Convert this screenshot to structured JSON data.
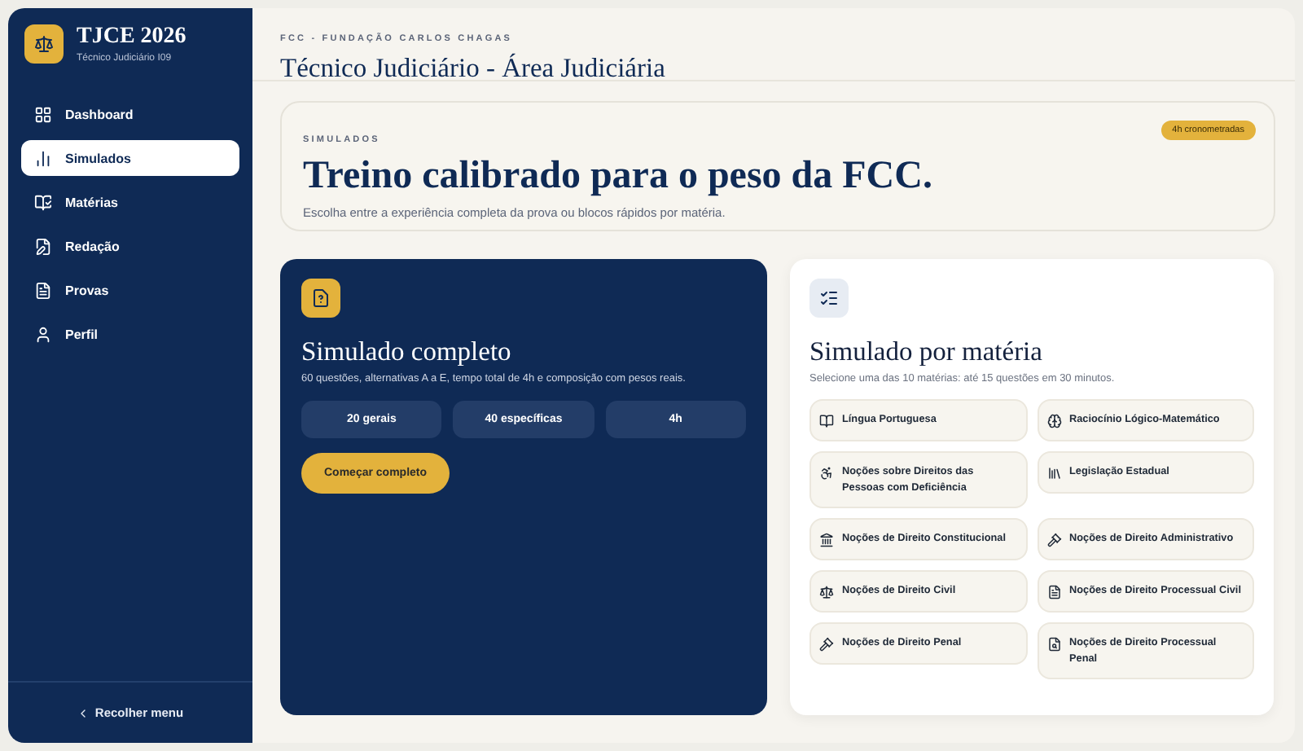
{
  "sidebar": {
    "brand": {
      "title": "TJCE 2026",
      "subtitle": "Técnico Judiciário I09"
    },
    "items": [
      {
        "label": "Dashboard",
        "selected": false
      },
      {
        "label": "Simulados",
        "selected": true
      },
      {
        "label": "Matérias",
        "selected": false
      },
      {
        "label": "Redação",
        "selected": false
      },
      {
        "label": "Provas",
        "selected": false
      },
      {
        "label": "Perfil",
        "selected": false
      }
    ],
    "collapse": "Recolher menu"
  },
  "header": {
    "eyebrow": "FCC - FUNDAÇÃO CARLOS CHAGAS",
    "title": "Técnico Judiciário - Área Judiciária"
  },
  "hero": {
    "eyebrow": "SIMULADOS",
    "title": "Treino calibrado para o peso da FCC.",
    "description": "Escolha entre a experiência completa da prova ou blocos rápidos por matéria.",
    "badge": "4h cronometradas"
  },
  "full_exam": {
    "title": "Simulado completo",
    "description": "60 questões, alternativas A a E, tempo total de 4h e composição com pesos reais.",
    "stats": [
      "20 gerais",
      "40 específicas",
      "4h"
    ],
    "button": "Começar completo"
  },
  "by_subject": {
    "title": "Simulado por matéria",
    "description": "Selecione uma das 10 matérias: até 15 questões em 30 minutos.",
    "subjects": [
      "Língua Portuguesa",
      "Raciocínio Lógico-Matemático",
      "Noções sobre Direitos das Pessoas com Deficiência",
      "Legislação Estadual",
      "Noções de Direito Constitucional",
      "Noções de Direito Administrativo",
      "Noções de Direito Civil",
      "Noções de Direito Processual Civil",
      "Noções de Direito Penal",
      "Noções de Direito Processual Penal"
    ]
  }
}
